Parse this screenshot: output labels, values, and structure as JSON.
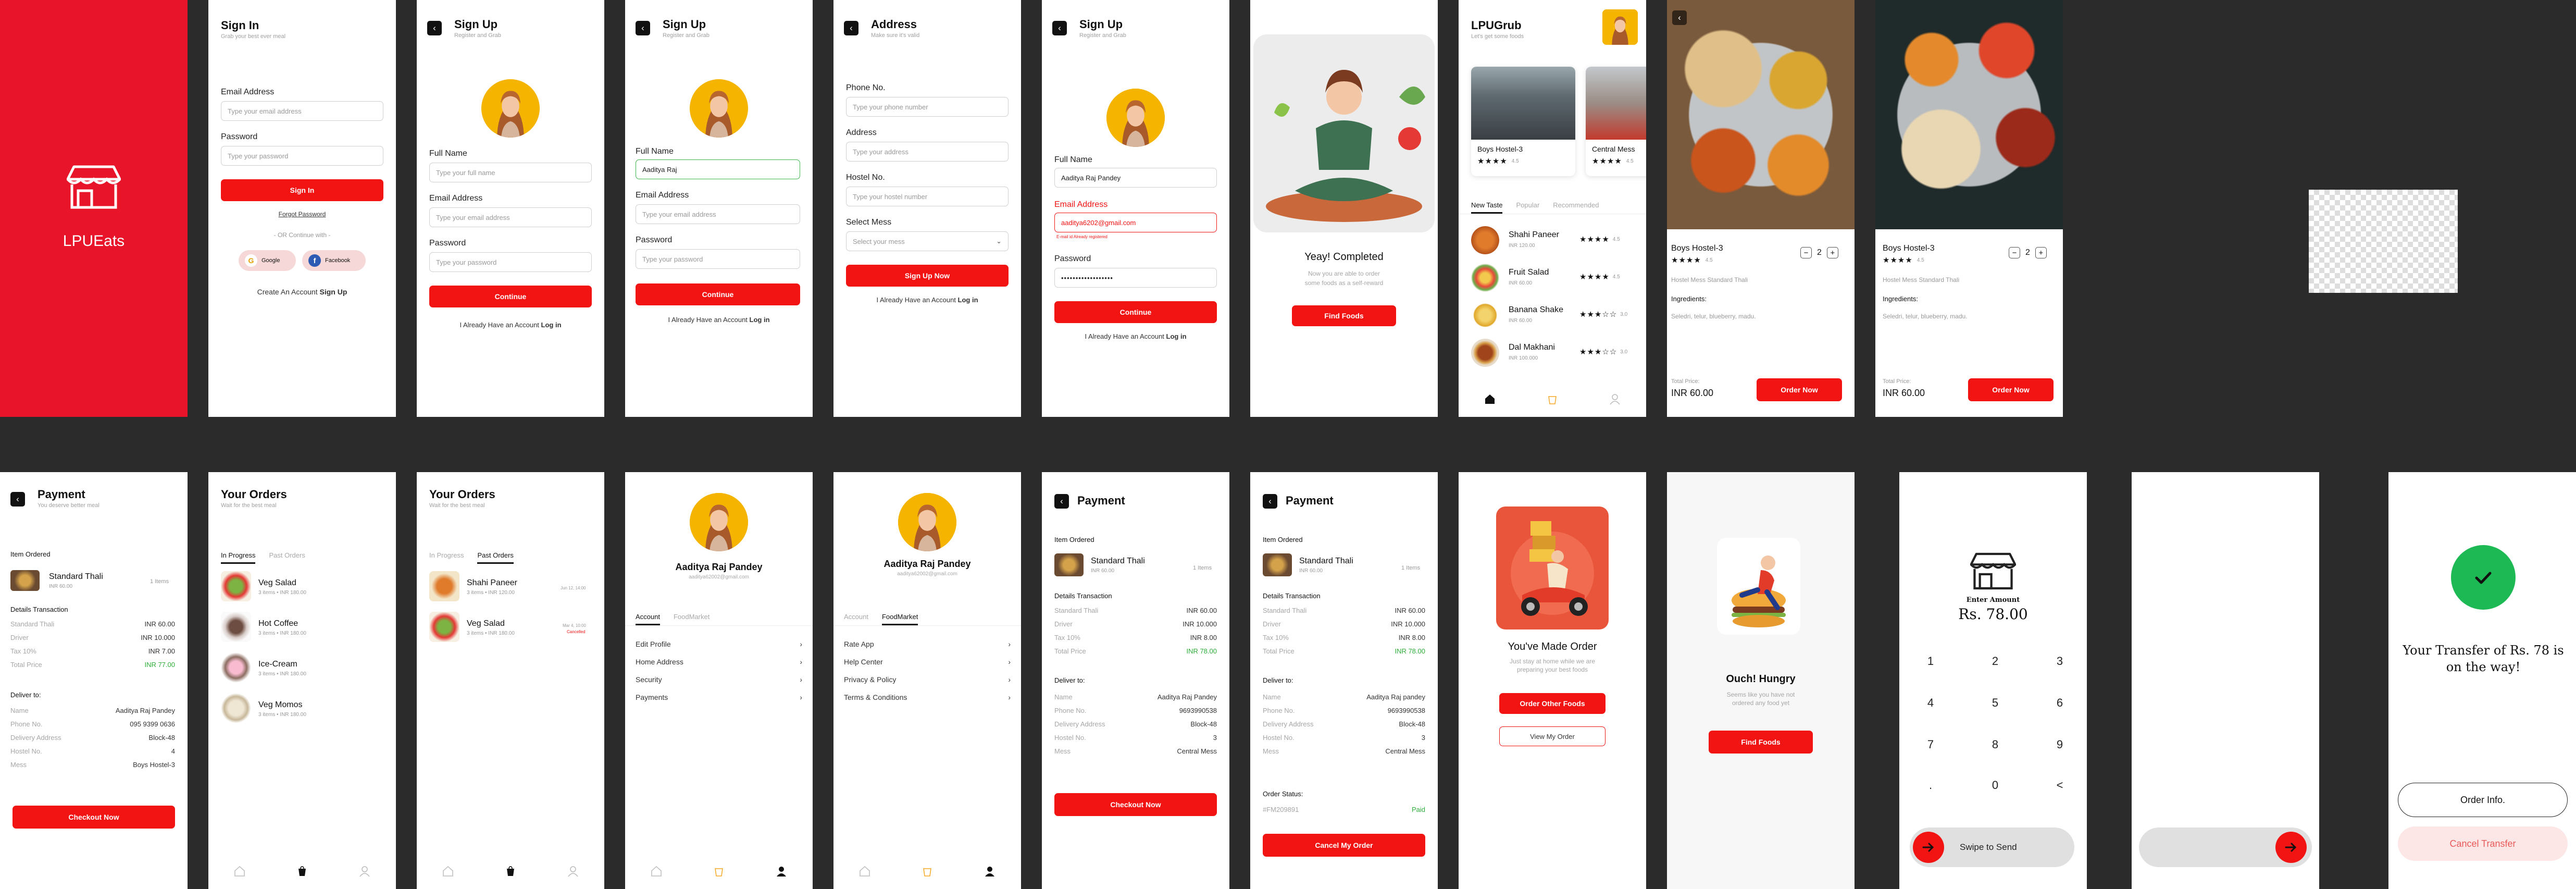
{
  "brand": {
    "name": "LPUEats",
    "color": "#F21313"
  },
  "signin": {
    "title": "Sign In",
    "subtitle": "Grab your best ever meal",
    "email_label": "Email Address",
    "email_placeholder": "Type your email address",
    "password_label": "Password",
    "password_placeholder": "Type your password",
    "button": "Sign In",
    "forgot": "Forgot Password",
    "or": "- OR Continue with -",
    "google": "Google",
    "facebook": "Facebook",
    "create_text": "Create An Account",
    "create_link": "Sign Up"
  },
  "signup1": {
    "title": "Sign Up",
    "subtitle": "Register and Grab",
    "name_label": "Full Name",
    "name_placeholder": "Type your full name",
    "email_label": "Email Address",
    "email_placeholder": "Type your email address",
    "password_label": "Password",
    "password_placeholder": "Type your password",
    "button": "Continue",
    "login_text": "I Already Have an Account",
    "login_link": "Log in"
  },
  "signup2": {
    "title": "Sign Up",
    "subtitle": "Register and Grab",
    "name_label": "Full Name",
    "name_value": "Aaditya Raj",
    "email_label": "Email Address",
    "email_placeholder": "Type your email address",
    "password_label": "Password",
    "password_placeholder": "Type your password",
    "button": "Continue",
    "login_text": "I Already Have an Account",
    "login_link": "Log in"
  },
  "address": {
    "title": "Address",
    "subtitle": "Make sure it's valid",
    "phone_label": "Phone No.",
    "phone_placeholder": "Type your phone number",
    "address_label": "Address",
    "address_placeholder": "Type your address",
    "hostel_label": "Hostel No.",
    "hostel_placeholder": "Type your hostel number",
    "mess_label": "Select Mess",
    "mess_placeholder": "Select your mess",
    "button": "Sign Up Now",
    "login_text": "I Already Have an Account",
    "login_link": "Log in"
  },
  "signup3": {
    "title": "Sign Up",
    "subtitle": "Register and Grab",
    "name_label": "Full Name",
    "name_value": "Aaditya Raj Pandey",
    "email_label": "Email Address",
    "email_value": "aaditya6202@gmail.com",
    "email_error": "E-mail id Already registered",
    "password_label": "Password",
    "password_value": "••••••••••••••••••",
    "button": "Continue",
    "login_text": "I Already Have an Account",
    "login_link": "Log in"
  },
  "completed": {
    "title": "Yeay! Completed",
    "text1": "Now you are able to order",
    "text2": "some foods as a self-reward",
    "button": "Find Foods"
  },
  "home": {
    "title": "LPUGrub",
    "subtitle": "Let's get some foods",
    "cards": [
      {
        "name": "Boys Hostel-3",
        "stars": "★★★★",
        "rating": "4.5"
      },
      {
        "name": "Central Mess",
        "stars": "★★★★",
        "rating": "4.5"
      }
    ],
    "tabs": [
      "New Taste",
      "Popular",
      "Recommended"
    ],
    "items": [
      {
        "name": "Shahi Paneer",
        "price": "INR 120.00",
        "stars": "★★★★",
        "rating": "4.5"
      },
      {
        "name": "Fruit Salad",
        "price": "INR 60.00",
        "stars": "★★★★",
        "rating": "4.5"
      },
      {
        "name": "Banana Shake",
        "price": "INR 60.00",
        "stars": "★★★☆☆",
        "rating": "3.0"
      },
      {
        "name": "Dal Makhani",
        "price": "INR 100.000",
        "stars": "★★★☆☆",
        "rating": "3.0"
      }
    ]
  },
  "detail1": {
    "title": "Boys Hostel-3",
    "stars": "★★★★",
    "rating": "4.5",
    "qty": "2",
    "desc": "Hostel Mess Standard Thali",
    "ingredients_label": "Ingredients:",
    "ingredients": "Seledri, telur, blueberry, madu.",
    "total_label": "Total Price:",
    "total": "INR 60.00",
    "button": "Order Now"
  },
  "detail2": {
    "title": "Boys Hostel-3",
    "stars": "★★★★",
    "rating": "4.5",
    "qty": "2",
    "desc": "Hostel Mess Standard Thali",
    "ingredients_label": "Ingredients:",
    "ingredients": "Seledri, telur, blueberry, madu.",
    "total_label": "Total Price:",
    "total": "INR 60.00",
    "button": "Order Now"
  },
  "payment1": {
    "title": "Payment",
    "subtitle": "You deserve better meal",
    "item_ordered": "Item Ordered",
    "item_name": "Standard Thali",
    "item_price": "INR 60.00",
    "item_qty": "1 Items",
    "details": "Details Transaction",
    "rows": [
      [
        "Standard Thali",
        "INR 60.00"
      ],
      [
        "Driver",
        "INR 10.000"
      ],
      [
        "Tax 10%",
        "INR 7.00"
      ],
      [
        "Total Price",
        "INR 77.00"
      ]
    ],
    "deliver": "Deliver to:",
    "deliver_rows": [
      [
        "Name",
        "Aaditya Raj Pandey"
      ],
      [
        "Phone No.",
        "095 9399 0636"
      ],
      [
        "Delivery Address",
        "Block-48"
      ],
      [
        "Hostel No.",
        "4"
      ],
      [
        "Mess",
        "Boys Hostel-3"
      ]
    ],
    "button": "Checkout Now"
  },
  "orders1": {
    "title": "Your Orders",
    "subtitle": "Wait for the best meal",
    "tabs": [
      "In Progress",
      "Past Orders"
    ],
    "items": [
      {
        "name": "Veg Salad",
        "meta": "3 items • INR 180.00"
      },
      {
        "name": "Hot Coffee",
        "meta": "3 items • INR 180.00"
      },
      {
        "name": "Ice-Cream",
        "meta": "3 items • INR 180.00"
      },
      {
        "name": "Veg Momos",
        "meta": "3 items • INR 180.00"
      }
    ]
  },
  "orders2": {
    "title": "Your Orders",
    "subtitle": "Wait for the best meal",
    "tabs": [
      "In Progress",
      "Past Orders"
    ],
    "items": [
      {
        "name": "Shahi Paneer",
        "meta": "3 items • INR 120.00",
        "date": "Jun 12, 14:00",
        "status": ""
      },
      {
        "name": "Veg Salad",
        "meta": "3 items • INR 180.00",
        "date": "Mar 4, 10:00",
        "status": "Cancelled"
      }
    ]
  },
  "profile1": {
    "name": "Aaditya Raj Pandey",
    "email": "aaditya62002@gmail.com",
    "tabs": [
      "Account",
      "FoodMarket"
    ],
    "menu": [
      "Edit Profile",
      "Home Address",
      "Security",
      "Payments"
    ]
  },
  "profile2": {
    "name": "Aaditya Raj Pandey",
    "email": "aaditya62002@gmail.com",
    "tabs": [
      "Account",
      "FoodMarket"
    ],
    "menu": [
      "Rate App",
      "Help Center",
      "Privacy & Policy",
      "Terms & Conditions"
    ]
  },
  "payment2": {
    "title": "Payment",
    "item_ordered": "Item Ordered",
    "item_name": "Standard Thali",
    "item_price": "INR 60.00",
    "item_qty": "1 Items",
    "details": "Details Transaction",
    "rows": [
      [
        "Standard Thali",
        "INR 60.00"
      ],
      [
        "Driver",
        "INR 10.000"
      ],
      [
        "Tax 10%",
        "INR 8.00"
      ],
      [
        "Total Price",
        "INR 78.00"
      ]
    ],
    "deliver": "Deliver to:",
    "deliver_rows": [
      [
        "Name",
        "Aaditya Raj Pandey"
      ],
      [
        "Phone No.",
        "9693990538"
      ],
      [
        "Delivery Address",
        "Block-48"
      ],
      [
        "Hostel No.",
        "3"
      ],
      [
        "Mess",
        "Central Mess"
      ]
    ],
    "button": "Checkout Now"
  },
  "payment3": {
    "title": "Payment",
    "item_ordered": "Item Ordered",
    "item_name": "Standard Thali",
    "item_price": "INR 60.00",
    "item_qty": "1 Items",
    "details": "Details Transaction",
    "rows": [
      [
        "Standard Thali",
        "INR 60.00"
      ],
      [
        "Driver",
        "INR 10.000"
      ],
      [
        "Tax 10%",
        "INR 8.00"
      ],
      [
        "Total Price",
        "INR 78.00"
      ]
    ],
    "deliver": "Deliver to:",
    "deliver_rows": [
      [
        "Name",
        "Aaditya Raj pandey"
      ],
      [
        "Phone No.",
        "9693990538"
      ],
      [
        "Delivery Address",
        "Block-48"
      ],
      [
        "Hostel No.",
        "3"
      ],
      [
        "Mess",
        "Central Mess"
      ]
    ],
    "status_label": "Order Status:",
    "order_id": "#FM209891",
    "order_status": "Paid",
    "button": "Cancel My Order"
  },
  "made": {
    "title": "You've Made Order",
    "text1": "Just stay at home while we are",
    "text2": "preparing your best foods",
    "button": "Order Other Foods",
    "button2": "View My Order"
  },
  "hungry": {
    "title": "Ouch! Hungry",
    "text1": "Seems like you have not",
    "text2": "ordered any food yet",
    "button": "Find Foods"
  },
  "transfer": {
    "label": "Enter Amount",
    "amount": "Rs. 78.00",
    "keys": [
      "1",
      "2",
      "3",
      "4",
      "5",
      "6",
      "7",
      "8",
      "9",
      ".",
      "0",
      "<"
    ],
    "swipe": "Swipe to Send"
  },
  "success": {
    "message": "Your Transfer of Rs. 78 is on the way!",
    "button": "Order Info.",
    "button2": "Cancel Transfer"
  }
}
